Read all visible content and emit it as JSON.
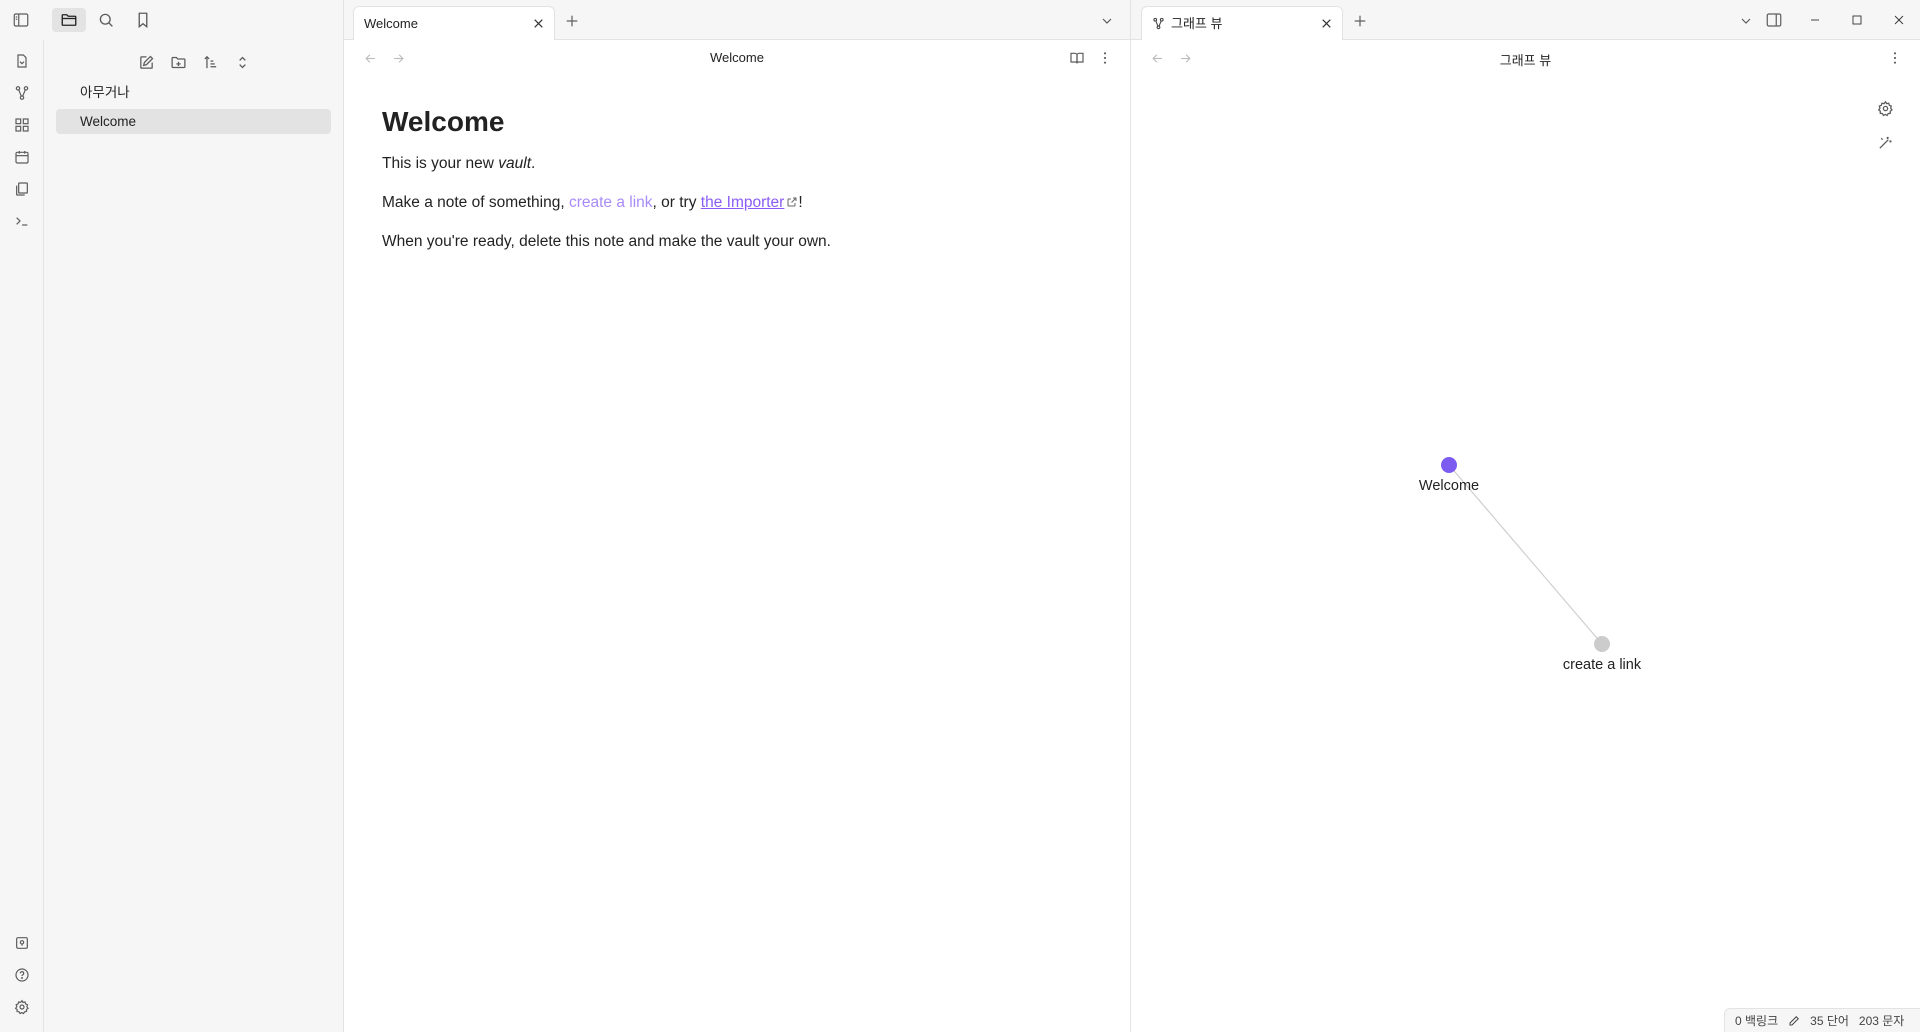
{
  "sidebar": {
    "files": [
      {
        "label": "아무거나"
      },
      {
        "label": "Welcome",
        "active": true
      }
    ]
  },
  "left_pane": {
    "tab_label": "Welcome",
    "view_title": "Welcome",
    "note": {
      "heading": "Welcome",
      "p1_text": "This is your new ",
      "p1_em": "vault",
      "p1_end": ".",
      "p2_start": "Make a note of something, ",
      "p2_link_internal": "create a link",
      "p2_mid": ", or try ",
      "p2_link_external": "the Importer",
      "p2_end": "!",
      "p3": "When you're ready, delete this note and make the vault your own."
    }
  },
  "right_pane": {
    "tab_label": "그래프 뷰",
    "view_title": "그래프 뷰",
    "graph": {
      "nodes": [
        {
          "label": "Welcome",
          "color": "#7c5cf0"
        },
        {
          "label": "create a link",
          "color": "#cccccc"
        }
      ],
      "edge_color": "#cfcfcf"
    }
  },
  "statusbar": {
    "backlinks": "0 백링크",
    "words": "35 단어",
    "chars": "203 문자"
  },
  "colors": {
    "accent": "#7c5cf0",
    "internal_link": "#a88bfa",
    "external_link": "#8a5cf5"
  }
}
